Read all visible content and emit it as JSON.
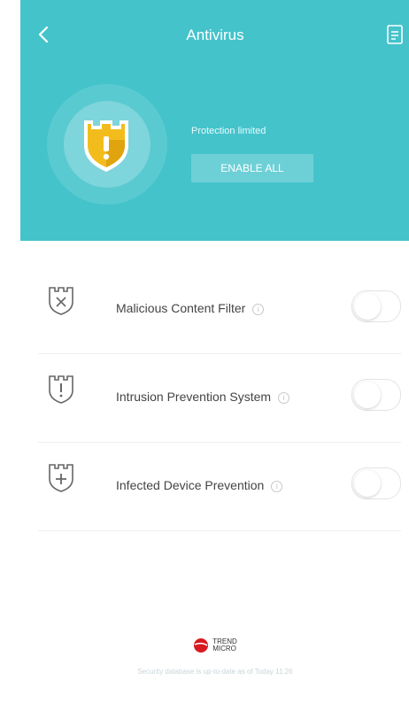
{
  "header": {
    "title": "Antivirus",
    "status_text": "Protection limited",
    "enable_all_label": "ENABLE ALL"
  },
  "features": [
    {
      "label": "Malicious Content Filter",
      "icon": "shield-x-icon",
      "enabled": false
    },
    {
      "label": "Intrusion Prevention System",
      "icon": "shield-exclamation-icon",
      "enabled": false
    },
    {
      "label": "Infected Device Prevention",
      "icon": "shield-plus-icon",
      "enabled": false
    }
  ],
  "footer": {
    "logo_text_line1": "TREND",
    "logo_text_line2": "MICRO",
    "update_text": "Security database is up-to-date as of Today 11:26"
  },
  "colors": {
    "accent": "#44c3cb",
    "shield_yellow": "#f2bd1c",
    "logo_red": "#d71920"
  }
}
